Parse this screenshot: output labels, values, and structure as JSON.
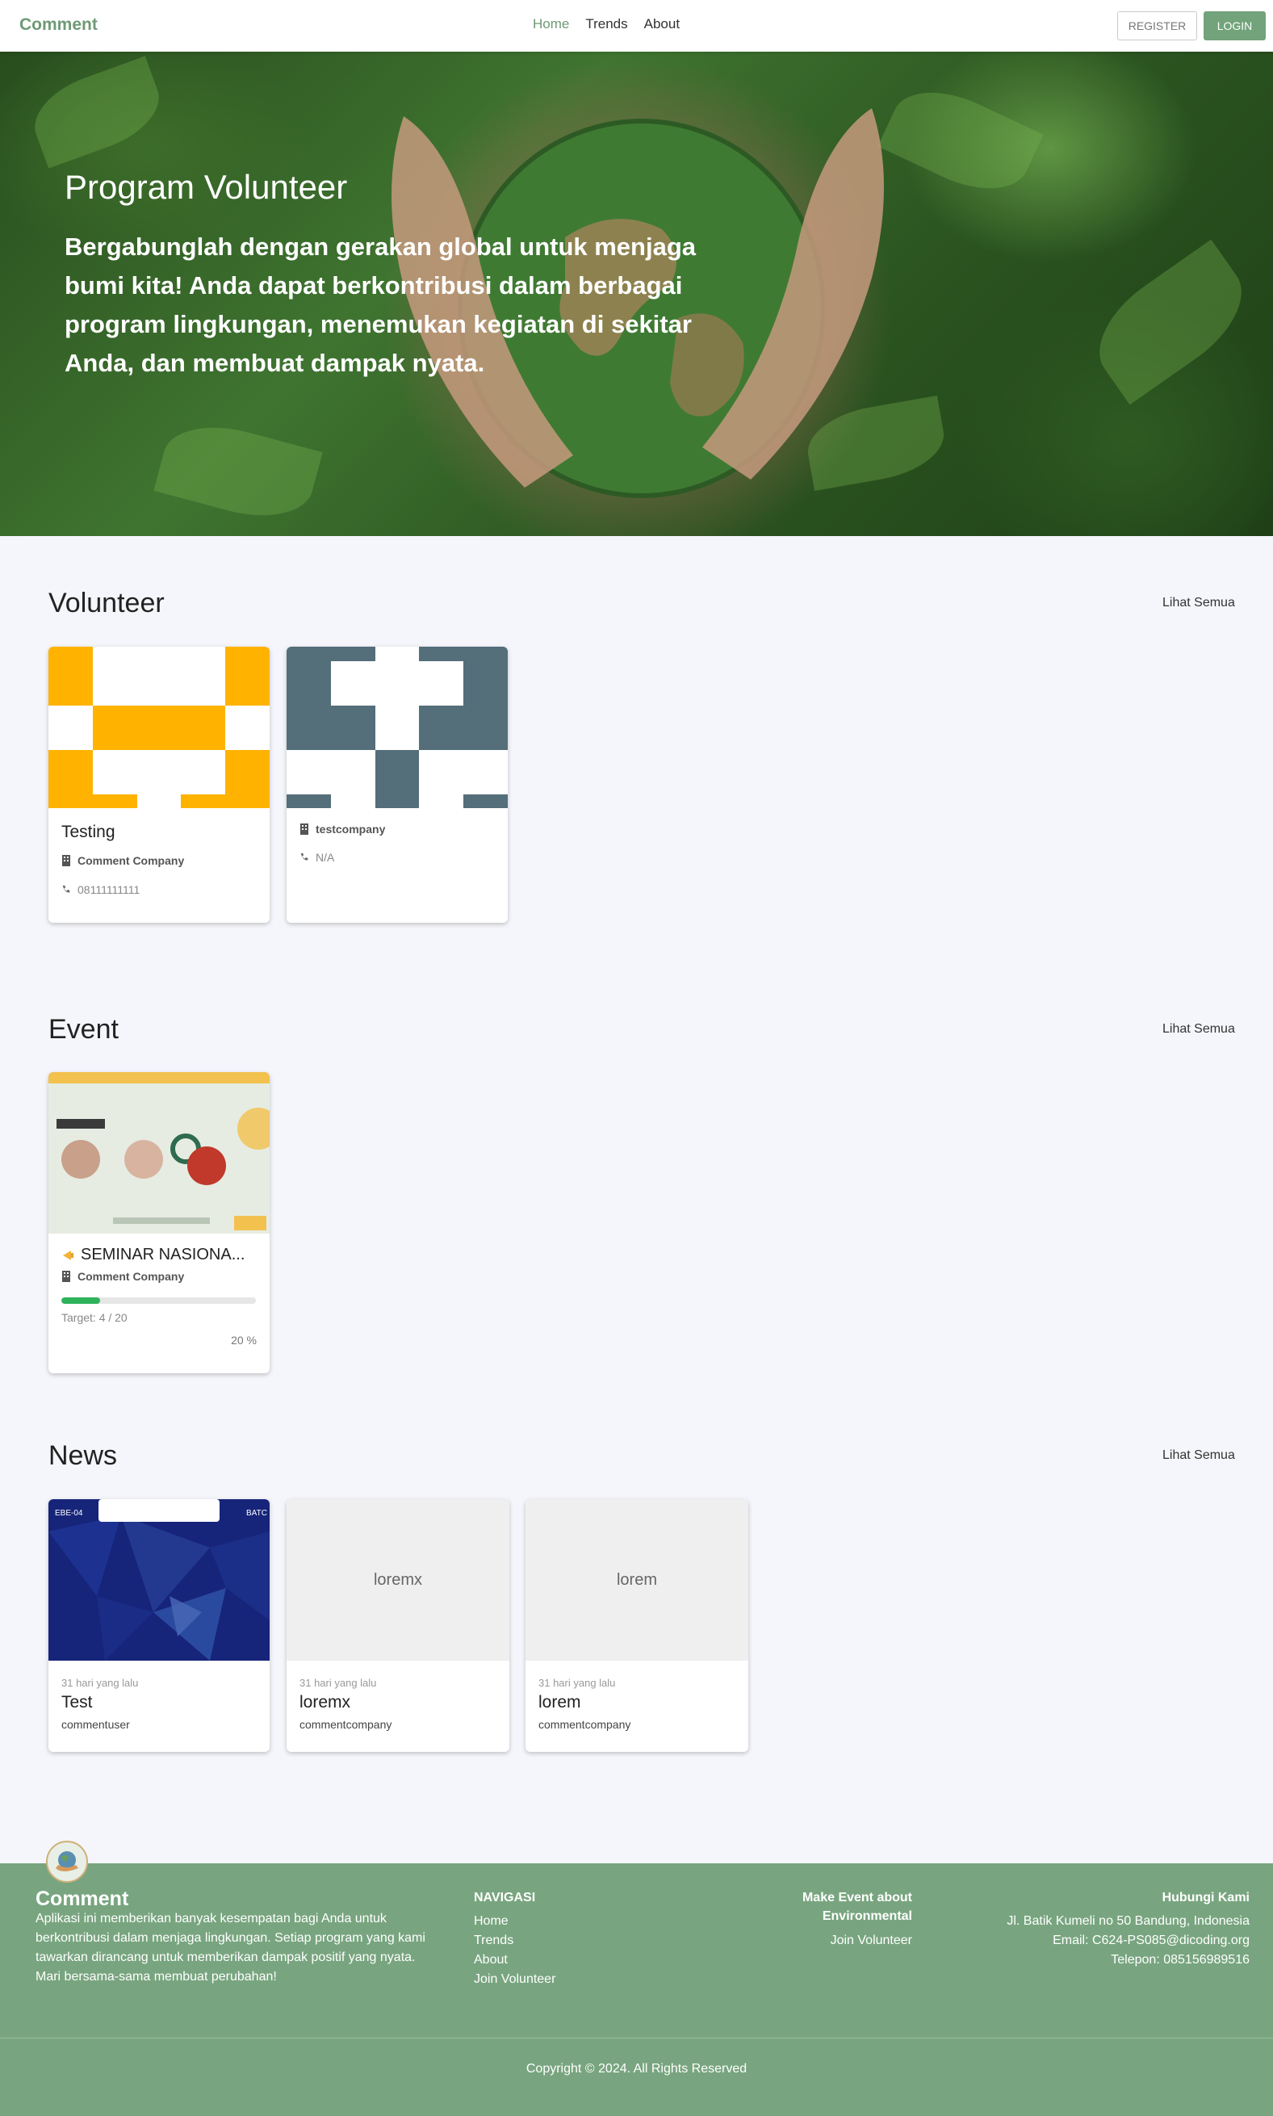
{
  "navbar": {
    "brand": "Comment",
    "links": [
      "Home",
      "Trends",
      "About"
    ],
    "register_label": "REGISTER",
    "login_label": "LOGIN"
  },
  "hero": {
    "title": "Program Volunteer",
    "description": "Bergabunglah dengan gerakan global untuk menjaga bumi kita! Anda dapat berkontribusi dalam berbagai program lingkungan, menemukan kegiatan di sekitar Anda, dan membuat dampak nyata."
  },
  "volunteer": {
    "title": "Volunteer",
    "see_all": "Lihat Semua",
    "cards": [
      {
        "name": "Testing",
        "company": "Comment Company",
        "phone": "08111111111",
        "color": "#ffb300"
      },
      {
        "name": "",
        "company": "testcompany",
        "phone": "N/A",
        "color": "#546e7a"
      }
    ]
  },
  "event": {
    "title": "Event",
    "see_all": "Lihat Semua",
    "cards": [
      {
        "name": "SEMINAR NASIONA...",
        "company": "Comment Company",
        "target": "Target: 4 / 20",
        "percent": "20 %",
        "progress": 0.2
      }
    ]
  },
  "news": {
    "title": "News",
    "see_all": "Lihat Semua",
    "cards": [
      {
        "time": "31 hari yang lalu",
        "title": "Test",
        "author": "commentuser",
        "placeholder": ""
      },
      {
        "time": "31 hari yang lalu",
        "title": "loremx",
        "author": "commentcompany",
        "placeholder": "loremx"
      },
      {
        "time": "31 hari yang lalu",
        "title": "lorem",
        "author": "commentcompany",
        "placeholder": "lorem"
      }
    ]
  },
  "footer": {
    "brand": "Comment",
    "description": "Aplikasi ini memberikan banyak kesempatan bagi Anda untuk berkontribusi dalam menjaga lingkungan. Setiap program yang kami tawarkan dirancang untuk memberikan dampak positif yang nyata. Mari bersama-sama membuat perubahan!",
    "nav_title": "NAVIGASI",
    "nav_links": [
      "Home",
      "Trends",
      "About",
      "Join Volunteer"
    ],
    "event_title_line1": "Make Event about",
    "event_title_line2": "Environmental",
    "event_link": "Join Volunteer",
    "contact_title": "Hubungi Kami",
    "address": "Jl. Batik Kumeli no 50 Bandung, Indonesia",
    "email": "Email: C624-PS085@dicoding.org",
    "phone": "Telepon: 085156989516",
    "copyright": "Copyright © 2024. All Rights Reserved"
  }
}
